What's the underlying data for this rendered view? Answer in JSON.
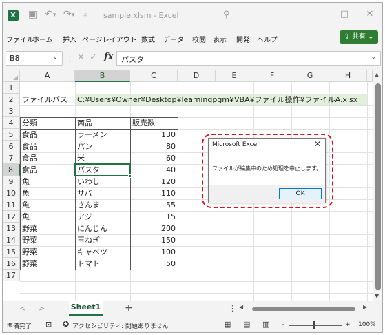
{
  "window": {
    "title": "sample.xlsm - Excel",
    "logo": "X",
    "minimize": "–",
    "maximize": "□",
    "close": "✕"
  },
  "quick_access": {
    "save_icon": "save-icon",
    "undo_icon": "undo-icon",
    "redo_icon": "redo-icon",
    "customize_icon": "customize-icon"
  },
  "ribbon_tabs": [
    "ファイル",
    "ホーム",
    "挿入",
    "ページレイアウト",
    "数式",
    "データ",
    "校閲",
    "表示",
    "開発",
    "ヘルプ"
  ],
  "share_button": "共有",
  "formula_bar": {
    "name_box": "B8",
    "fx": "fx",
    "content": "パスタ"
  },
  "columns": [
    "A",
    "B",
    "C",
    "D",
    "E",
    "F",
    "G",
    "H"
  ],
  "selected_column": "B",
  "rows": [
    "1",
    "2",
    "3",
    "4",
    "5",
    "6",
    "7",
    "8",
    "9",
    "10",
    "11",
    "12",
    "13",
    "14",
    "15",
    "16",
    "17"
  ],
  "selected_row": "8",
  "cells": {
    "A2": "ファイルパス",
    "B2": "C:¥Users¥Owner¥Desktop¥learningpgm¥VBA¥ファイル操作¥ファイルA.xlsx",
    "header": [
      "分類",
      "商品",
      "販売数"
    ],
    "table": [
      [
        "食品",
        "ラーメン",
        "130"
      ],
      [
        "食品",
        "パン",
        "80"
      ],
      [
        "食品",
        "米",
        "60"
      ],
      [
        "食品",
        "パスタ",
        "40"
      ],
      [
        "魚",
        "いわし",
        "120"
      ],
      [
        "魚",
        "サバ",
        "110"
      ],
      [
        "魚",
        "さんま",
        "55"
      ],
      [
        "魚",
        "アジ",
        "15"
      ],
      [
        "野菜",
        "にんじん",
        "200"
      ],
      [
        "野菜",
        "玉ねぎ",
        "150"
      ],
      [
        "野菜",
        "キャベツ",
        "100"
      ],
      [
        "野菜",
        "トマト",
        "50"
      ]
    ]
  },
  "dialog": {
    "title": "Microsoft Excel",
    "message": "ファイルが編集中のため処理を中止します。",
    "ok": "OK",
    "close": "✕"
  },
  "sheet_tabs": {
    "active": "Sheet1",
    "add": "+"
  },
  "status_bar": {
    "ready": "準備完了",
    "accessibility": "アクセシビリティ: 問題ありません",
    "zoom_minus": "–",
    "zoom_plus": "+",
    "zoom": "100%"
  },
  "colors": {
    "excel_green": "#217346",
    "path_highlight": "#e2efda",
    "dialog_highlight": "#e0101a"
  }
}
